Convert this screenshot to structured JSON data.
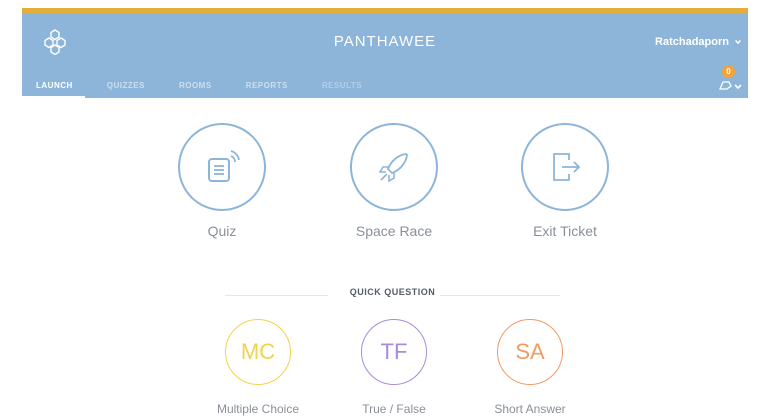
{
  "header": {
    "brand": "PANTHAWEE",
    "user_name": "Ratchadaporn",
    "notification_count": "0",
    "tabs": [
      {
        "label": "LAUNCH",
        "state": "active"
      },
      {
        "label": "QUIZZES",
        "state": "normal"
      },
      {
        "label": "ROOMS",
        "state": "normal"
      },
      {
        "label": "REPORTS",
        "state": "normal"
      },
      {
        "label": "RESULTS",
        "state": "disabled"
      }
    ]
  },
  "launch": {
    "items": [
      {
        "label": "Quiz",
        "icon": "quiz-icon"
      },
      {
        "label": "Space Race",
        "icon": "rocket-icon"
      },
      {
        "label": "Exit Ticket",
        "icon": "exit-ticket-icon"
      }
    ]
  },
  "quick_question": {
    "title": "QUICK QUESTION",
    "items": [
      {
        "abbr": "MC",
        "label": "Multiple Choice",
        "color": "#f2d24b"
      },
      {
        "abbr": "TF",
        "label": "True / False",
        "color": "#a98bd6"
      },
      {
        "abbr": "SA",
        "label": "Short Answer",
        "color": "#f29a62"
      }
    ]
  },
  "colors": {
    "accent_bar": "#e3ad3c",
    "header_bg": "#8db5d9",
    "badge": "#f2a33a"
  }
}
